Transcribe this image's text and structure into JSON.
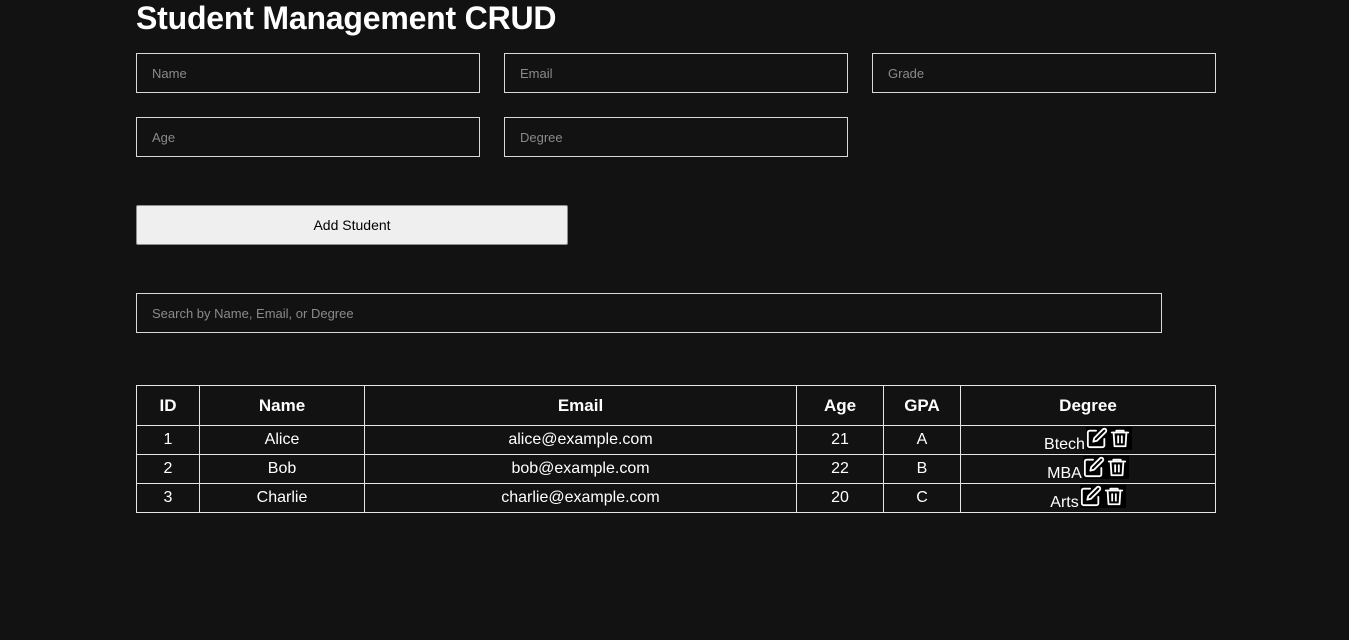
{
  "header": {
    "title": "Student Management CRUD"
  },
  "form": {
    "name_placeholder": "Name",
    "email_placeholder": "Email",
    "grade_placeholder": "Grade",
    "age_placeholder": "Age",
    "degree_placeholder": "Degree",
    "add_button_label": "Add Student"
  },
  "search": {
    "placeholder": "Search by Name, Email, or Degree"
  },
  "table": {
    "headers": {
      "id": "ID",
      "name": "Name",
      "email": "Email",
      "age": "Age",
      "gpa": "GPA",
      "degree": "Degree"
    },
    "rows": [
      {
        "id": "1",
        "name": "Alice",
        "email": "alice@example.com",
        "age": "21",
        "gpa": "A",
        "degree": "Btech"
      },
      {
        "id": "2",
        "name": "Bob",
        "email": "bob@example.com",
        "age": "22",
        "gpa": "B",
        "degree": "MBA"
      },
      {
        "id": "3",
        "name": "Charlie",
        "email": "charlie@example.com",
        "age": "20",
        "gpa": "C",
        "degree": "Arts"
      }
    ]
  },
  "icons": {
    "edit": "edit-icon",
    "delete": "trash-icon"
  }
}
